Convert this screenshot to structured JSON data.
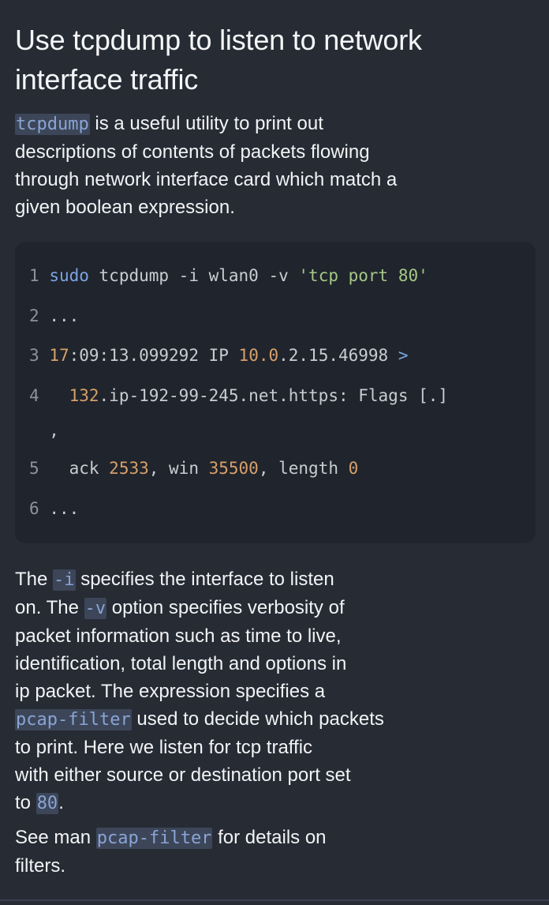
{
  "title": "Use tcpdump to listen to network interface traffic",
  "title_lines": [
    "Use tcpdump to listen to network",
    "interface traffic"
  ],
  "intro": {
    "code": "tcpdump",
    "l1": " is a useful utility to print out",
    "l2": "descriptions of contents of packets flowing",
    "l3": "through network interface card which match a",
    "l4": "given boolean expression."
  },
  "code_block": {
    "lines": [
      {
        "num": "1",
        "sudo": "sudo",
        "cmd": " tcpdump -i wlan0 -v ",
        "str": "'tcp port 80'"
      },
      {
        "num": "2",
        "text": "..."
      },
      {
        "num": "3",
        "t1": "17",
        "t2": ":09:13.099292 IP ",
        "t3": "10.0",
        "t4": ".2.15.46998 ",
        "t5": ">"
      },
      {
        "num": "4",
        "t1": "132",
        "t2": ".ip-192-99-245.net.https: Flags [.]"
      },
      {
        "wrap": ","
      },
      {
        "num": "5",
        "t1": "ack ",
        "t2": "2533",
        "t3": ", win ",
        "t4": "35500",
        "t5": ", length ",
        "t6": "0"
      },
      {
        "num": "6",
        "text": "..."
      }
    ]
  },
  "explanation": {
    "p1_a": "The ",
    "p1_code_i": "-i",
    "p1_b": " specifies the interface to listen",
    "p2_a": "on. The ",
    "p2_code_v": "-v",
    "p2_b": " option specifies verbosity of",
    "p3": "packet information such as time to live,",
    "p4": "identification, total length and options in",
    "p5": "ip packet. The expression specifies a",
    "p6_code": "pcap-filter",
    "p6_b": " used to decide which packets",
    "p7": "to print. Here we listen for tcp traffic",
    "p8": "with either source or destination port set",
    "p9_a": "to ",
    "p9_code": "80",
    "p9_b": "."
  },
  "see_man": {
    "a": "See man ",
    "code": "pcap-filter",
    "b": " for details on",
    "l2": "filters."
  },
  "colors": {
    "background": "#272b34",
    "code_background": "#20242c",
    "inline_code_bg": "#3c4658",
    "inline_code_fg": "#8aa4d6",
    "keyword": "#7aa4e4",
    "string": "#a4c887",
    "number": "#d6a06a"
  }
}
